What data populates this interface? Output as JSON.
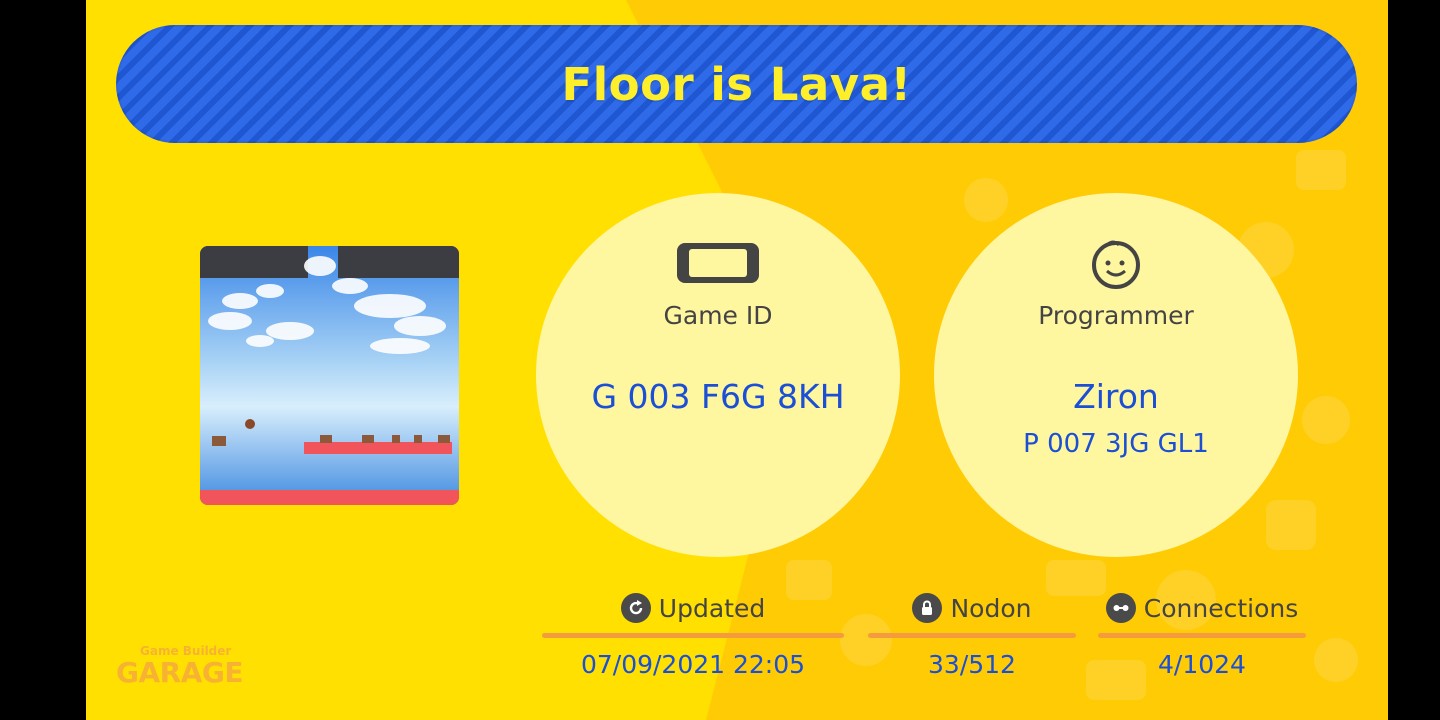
{
  "title": "Floor is Lava!",
  "game_id": {
    "label": "Game ID",
    "value": "G 003 F6G 8KH",
    "icon": "switch-console-icon"
  },
  "programmer": {
    "label": "Programmer",
    "name": "Ziron",
    "id": "P 007 3JG GL1",
    "icon": "smiley-face-icon"
  },
  "stats": {
    "updated": {
      "label": "Updated",
      "value": "07/09/2021 22:05",
      "icon": "refresh-icon"
    },
    "nodon": {
      "label": "Nodon",
      "value": "33/512",
      "icon": "lock-icon"
    },
    "connections": {
      "label": "Connections",
      "value": "4/1024",
      "icon": "link-icon"
    }
  },
  "logo": {
    "line1": "Game Builder",
    "line2": "GARAGE"
  },
  "colors": {
    "background": "#ffe000",
    "banner": "#2f6be8",
    "title": "#ffef2a",
    "circle": "#fff6a0",
    "value_text": "#1a4fd6",
    "rule": "#f59a3d"
  }
}
